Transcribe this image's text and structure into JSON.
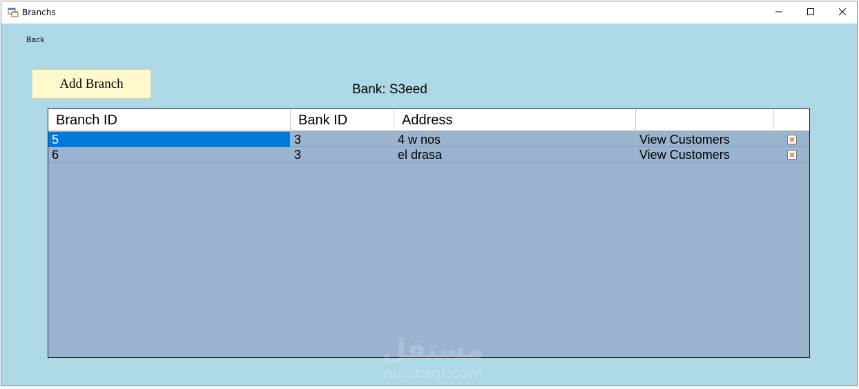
{
  "window": {
    "title": "Branchs"
  },
  "nav": {
    "back_label": "Back"
  },
  "toolbar": {
    "add_branch_label": "Add Branch"
  },
  "bank": {
    "label": "Bank: S3eed"
  },
  "grid": {
    "columns": [
      "Branch ID",
      "Bank ID",
      "Address",
      "",
      ""
    ],
    "rows": [
      {
        "branch_id": "5",
        "bank_id": "3",
        "address": "4 w nos",
        "action": "View Customers",
        "selected": true
      },
      {
        "branch_id": "6",
        "bank_id": "3",
        "address": "el drasa",
        "action": "View Customers",
        "selected": false
      }
    ]
  },
  "watermark": {
    "arabic": "مستقل",
    "latin": "mostaql.com"
  },
  "colors": {
    "form_background": "#add8e6",
    "grid_background": "#9ab4d0",
    "selection": "#0078d7",
    "button_background": "#fffacd"
  },
  "icons": {
    "app": "window-app-icon",
    "minimize": "minimize-icon",
    "maximize": "maximize-icon",
    "close": "close-icon",
    "delete": "delete-icon"
  }
}
